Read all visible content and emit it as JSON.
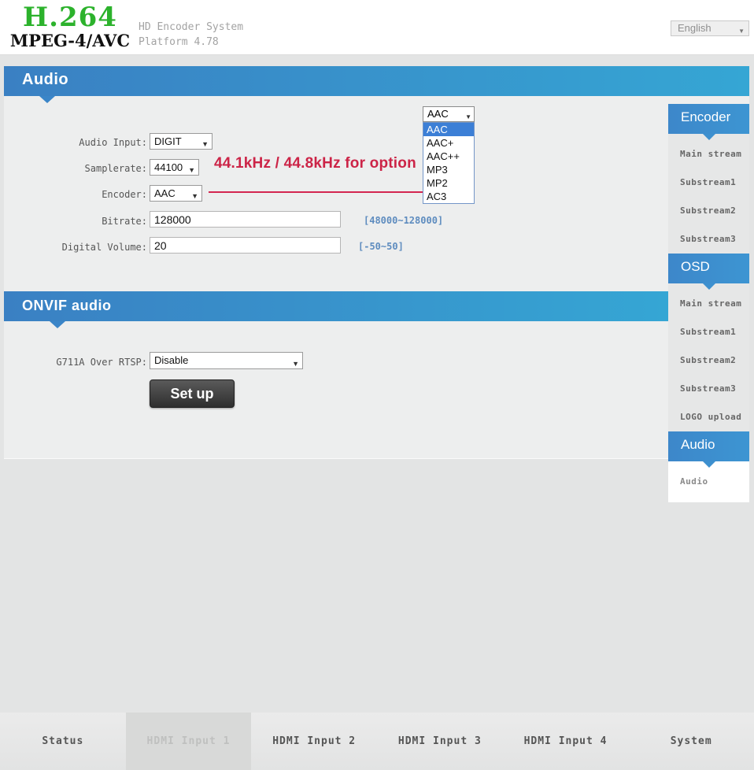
{
  "header": {
    "logo_line1": "H.264",
    "logo_line2": "MPEG-4/AVC",
    "subtitle_line1": "HD Encoder System",
    "subtitle_line2": "Platform 4.78",
    "language_selected": "English"
  },
  "icons": {
    "dropdown_arrow": "▼"
  },
  "audio_section": {
    "title": "Audio",
    "audio_input_label": "Audio Input:",
    "audio_input_value": "DIGIT",
    "samplerate_label": "Samplerate:",
    "samplerate_value": "44100",
    "samplerate_note": "44.1kHz / 44.8kHz for option",
    "encoder_label": "Encoder:",
    "encoder_value": "AAC",
    "bitrate_label": "Bitrate:",
    "bitrate_value": "128000",
    "bitrate_hint": "[48000~128000]",
    "volume_label": "Digital Volume:",
    "volume_value": "20",
    "volume_hint": "[-50~50]"
  },
  "encoder_dropdown": {
    "selected": "AAC",
    "highlighted": "AAC",
    "options": [
      "AAC",
      "AAC+",
      "AAC++",
      "MP3",
      "MP2",
      "AC3"
    ]
  },
  "onvif_section": {
    "title": "ONVIF audio",
    "g711a_label": "G711A Over RTSP:",
    "g711a_value": "Disable",
    "setup_button": "Set up"
  },
  "sidebar": {
    "sections": [
      {
        "title": "Encoder",
        "items": [
          "Main stream",
          "Substream1",
          "Substream2",
          "Substream3"
        ]
      },
      {
        "title": "OSD",
        "items": [
          "Main stream",
          "Substream1",
          "Substream2",
          "Substream3",
          "LOGO upload"
        ]
      },
      {
        "title": "Audio",
        "items": [
          "Audio"
        ],
        "active_item": "Audio"
      }
    ]
  },
  "bottom_nav": {
    "items": [
      {
        "label": "Status",
        "active": false
      },
      {
        "label": "HDMI Input 1",
        "active": true
      },
      {
        "label": "HDMI Input 2",
        "active": false
      },
      {
        "label": "HDMI Input 3",
        "active": false
      },
      {
        "label": "HDMI Input 4",
        "active": false
      },
      {
        "label": "System",
        "active": false
      }
    ]
  },
  "colors": {
    "accent_blue_left": "#3a80c3",
    "accent_blue_right": "#35a6d4",
    "logo_green": "#2cb22c",
    "annotation_red": "#cc2447",
    "hint_blue": "#5e8cbf",
    "dropdown_highlight": "#3c7fd6"
  }
}
